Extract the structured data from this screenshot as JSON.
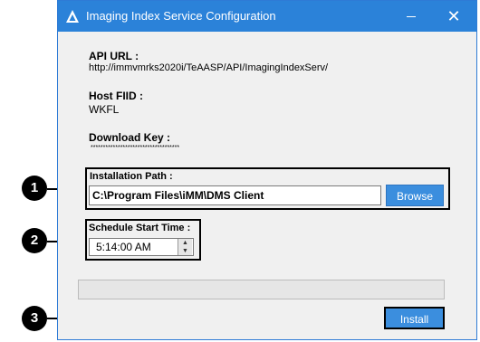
{
  "window": {
    "title": "Imaging Index Service Configuration",
    "close_glyph": "✕",
    "icons": {
      "app": "triangle-logo-icon",
      "minimize": "minimize-icon",
      "close": "close-icon"
    }
  },
  "api_url": {
    "label": "API URL :",
    "value": "http://immvmrks2020i/TeAASP/API/ImagingIndexServ/"
  },
  "host_fiid": {
    "label": "Host FIID :",
    "value": "WKFL"
  },
  "download_key": {
    "label": "Download Key :",
    "value": "************************************"
  },
  "installation_path": {
    "label": "Installation Path :",
    "value": "C:\\Program Files\\iMM\\DMS Client",
    "browse_label": "Browse"
  },
  "schedule": {
    "label": "Schedule Start Time :",
    "value": "5:14:00 AM",
    "up_glyph": "▲",
    "down_glyph": "▼"
  },
  "progress": {
    "value": 0
  },
  "install_label": "Install",
  "callouts": [
    "1",
    "2",
    "3"
  ],
  "colors": {
    "titlebar": "#2b82d9",
    "button": "#3b8ede",
    "callout": "#000000"
  }
}
